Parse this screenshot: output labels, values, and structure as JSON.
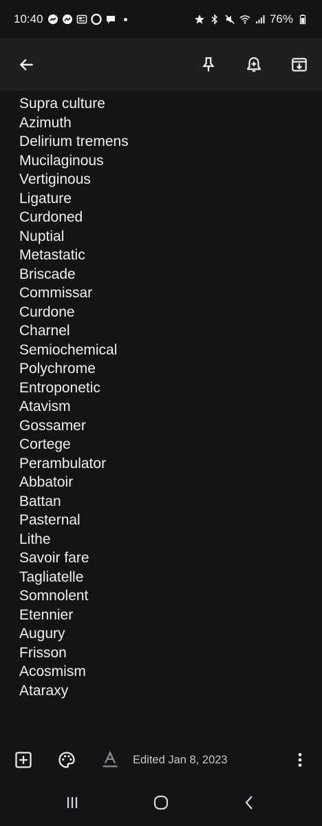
{
  "status_bar": {
    "time": "10:40",
    "battery": "76%",
    "left_icons": [
      "messenger-icon",
      "messenger-icon",
      "news-icon",
      "opera-icon",
      "chat-bubble-icon"
    ],
    "right_icons": [
      "star-icon",
      "bluetooth-icon",
      "mute-icon",
      "wifi-icon",
      "signal-icon",
      "battery-icon"
    ]
  },
  "app_bar": {
    "back_icon": "arrow-back-icon",
    "pin_icon": "pin-icon",
    "reminder_icon": "add-alert-icon",
    "archive_icon": "archive-icon"
  },
  "note": {
    "lines": [
      "Supra culture",
      "Azimuth",
      "Delirium tremens",
      "Mucilaginous",
      "Vertiginous",
      "Ligature",
      "Curdoned",
      "Nuptial",
      "Metastatic",
      "Briscade",
      "Commissar",
      "Curdone",
      "Charnel",
      "Semiochemical",
      "Polychrome",
      "Entroponetic",
      "Atavism",
      "Gossamer",
      "Cortege",
      "Perambulator",
      "Abbatoir",
      "Battan",
      "Pasternal",
      "Lithe",
      "Savoir fare",
      "Tagliatelle",
      "Somnolent",
      "Etennier",
      "Augury",
      "Frisson",
      "Acosmism",
      "Ataraxy"
    ]
  },
  "bottom_toolbar": {
    "edited_label": "Edited Jan 8, 2023",
    "add_icon": "add-box-icon",
    "palette_icon": "palette-icon",
    "format_icon": "text-format-icon",
    "more_icon": "more-vert-icon"
  },
  "colors": {
    "background": "#141417",
    "app_bar": "#1f1f22",
    "text": "#f0f0f2"
  }
}
